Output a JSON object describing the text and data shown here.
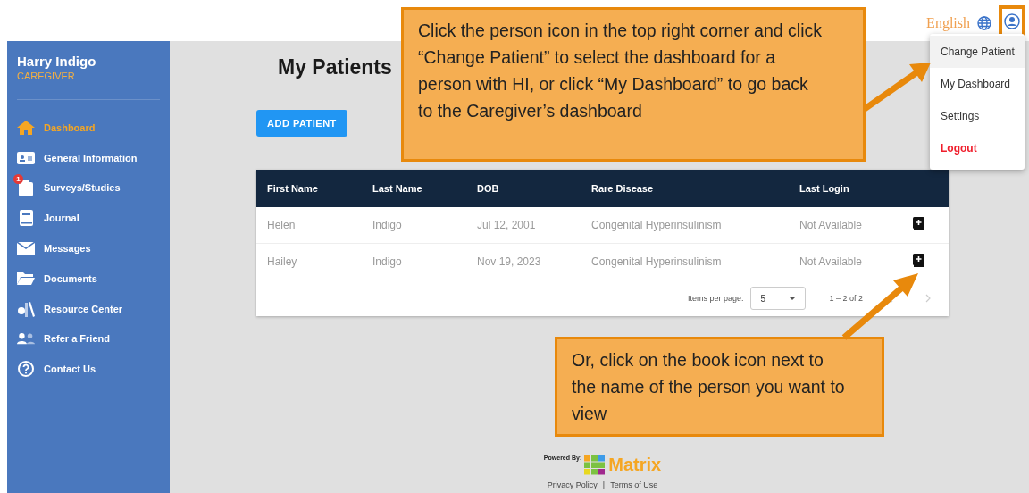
{
  "header": {
    "language": "English"
  },
  "user_menu": [
    {
      "label": "Change Patient",
      "selected": true,
      "kind": "normal"
    },
    {
      "label": "My Dashboard",
      "selected": false,
      "kind": "normal"
    },
    {
      "label": "Settings",
      "selected": false,
      "kind": "normal"
    },
    {
      "label": "Logout",
      "selected": false,
      "kind": "danger"
    }
  ],
  "sidebar": {
    "user_name": "Harry Indigo",
    "role": "CAREGIVER",
    "items": [
      {
        "label": "Dashboard",
        "selected": true
      },
      {
        "label": "General Information",
        "selected": false
      },
      {
        "label": "Surveys/Studies",
        "selected": false,
        "badge": "1"
      },
      {
        "label": "Journal",
        "selected": false
      },
      {
        "label": "Messages",
        "selected": false
      },
      {
        "label": "Documents",
        "selected": false
      },
      {
        "label": "Resource Center",
        "selected": false
      },
      {
        "label": "Refer a Friend",
        "selected": false
      },
      {
        "label": "Contact Us",
        "selected": false
      }
    ]
  },
  "page_title": "My Patients",
  "add_button": "ADD PATIENT",
  "table": {
    "columns": [
      "First Name",
      "Last Name",
      "DOB",
      "Rare Disease",
      "Last Login"
    ],
    "rows": [
      [
        "Helen",
        "Indigo",
        "Jul 12, 2001",
        "Congenital Hyperinsulinism",
        "Not Available"
      ],
      [
        "Hailey",
        "Indigo",
        "Nov 19, 2023",
        "Congenital Hyperinsulinism",
        "Not Available"
      ]
    ],
    "items_per_page_label": "Items per page:",
    "items_per_page": "5",
    "range": "1 – 2 of 2"
  },
  "footer": {
    "powered_by": "Powered By:",
    "brand": "Matrix",
    "links": [
      "Privacy Policy",
      "Terms of Use"
    ],
    "separator": "|"
  },
  "callouts": [
    {
      "text": "Click the person icon in the top right corner and click “Change Patient” to select the dashboard for a person with HI, or click “My Dashboard” to go back to the Caregiver’s dashboard"
    },
    {
      "text": "Or, click on the book icon next to the name of the person you want to view"
    }
  ]
}
